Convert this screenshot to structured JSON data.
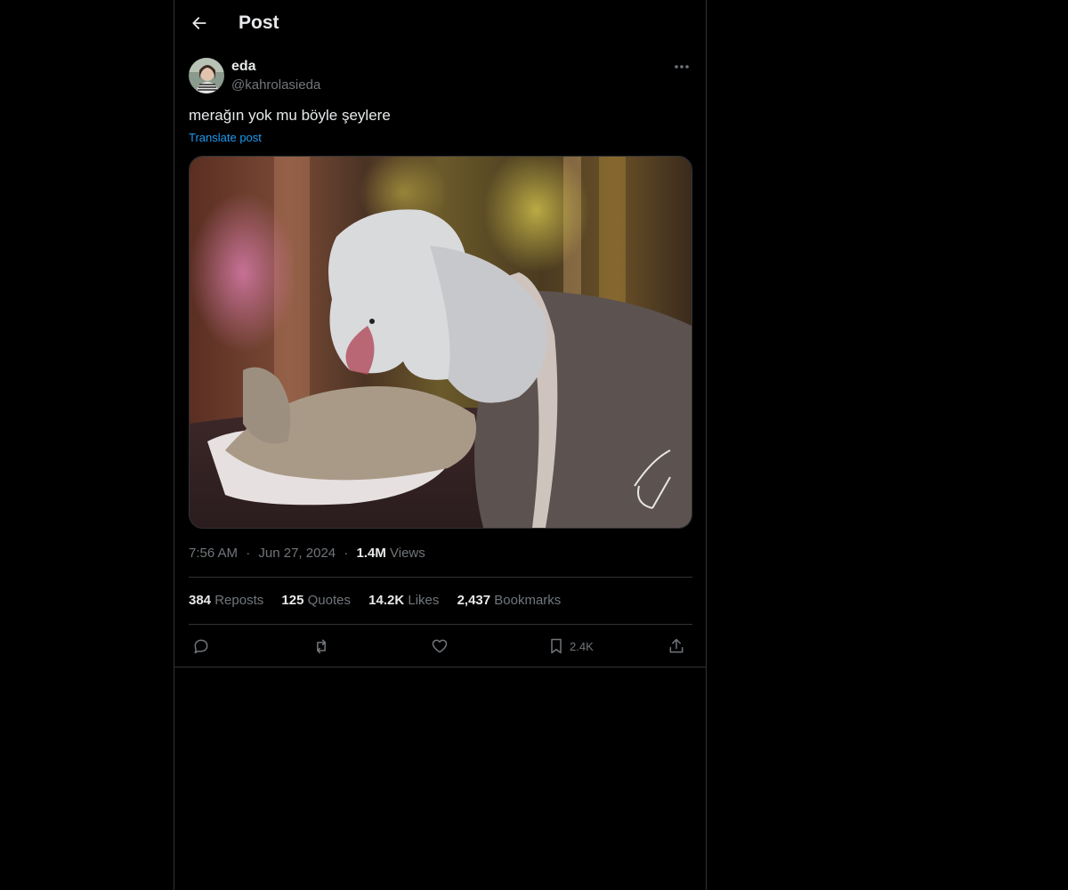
{
  "header": {
    "title": "Post",
    "back_icon": "arrow-left-icon"
  },
  "author": {
    "display_name": "eda",
    "handle": "@kahrolasieda",
    "more_icon": "more-horizontal-icon"
  },
  "post": {
    "text": "merağın yok mu böyle şeylere",
    "translate_label": "Translate post",
    "media_signature": "AW"
  },
  "meta": {
    "time": "7:56 AM",
    "separator": "·",
    "date": "Jun 27, 2024",
    "views_count": "1.4M",
    "views_label": "Views"
  },
  "stats": {
    "reposts_count": "384",
    "reposts_label": "Reposts",
    "quotes_count": "125",
    "quotes_label": "Quotes",
    "likes_count": "14.2K",
    "likes_label": "Likes",
    "bookmarks_count": "2,437",
    "bookmarks_label": "Bookmarks"
  },
  "actions": {
    "reply_icon": "reply-icon",
    "repost_icon": "repost-icon",
    "like_icon": "heart-icon",
    "bookmark_icon": "bookmark-icon",
    "bookmark_count": "2.4K",
    "share_icon": "share-icon"
  },
  "colors": {
    "background": "#000000",
    "text": "#e7e9ea",
    "secondary": "#71767b",
    "link": "#1d9bf0",
    "border": "#2f3336"
  }
}
